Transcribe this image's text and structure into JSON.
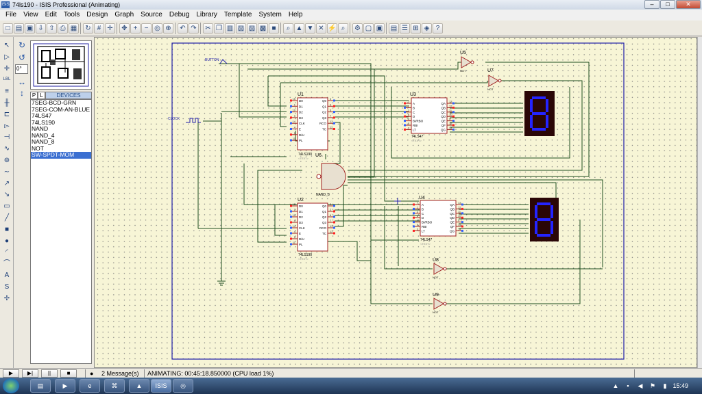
{
  "window": {
    "title": "74ls190 - ISIS Professional (Animating)",
    "app_icon": "ISIS",
    "minimize": "–",
    "maximize": "□",
    "close": "✕"
  },
  "menu": [
    "File",
    "View",
    "Edit",
    "Tools",
    "Design",
    "Graph",
    "Source",
    "Debug",
    "Library",
    "Template",
    "System",
    "Help"
  ],
  "toolbar_icons": [
    "new-file-icon",
    "open-folder-icon",
    "save-icon",
    "import-icon",
    "export-icon",
    "print-icon",
    "print-setup-icon",
    "refresh-icon",
    "grid-icon",
    "origin-icon",
    "pan-icon",
    "zoom-in-icon",
    "zoom-out-icon",
    "zoom-all-icon",
    "zoom-area-icon",
    "undo-icon",
    "redo-icon",
    "cut-icon",
    "copy-icon",
    "paste-icon",
    "block-copy-icon",
    "block-move-icon",
    "block-rotate-icon",
    "block-delete-icon",
    "pick-device-icon",
    "make-device-icon",
    "package-icon",
    "decompose-icon",
    "wire-autorouter-icon",
    "search-tag-icon",
    "property-tool-icon",
    "new-sheet-icon",
    "remove-sheet-icon",
    "goto-sheet-icon",
    "bom-icon",
    "netlist-icon",
    "design-explorer-icon",
    "help-icon"
  ],
  "tool_icons": [
    "selection-icon",
    "component-icon",
    "junction-icon",
    "wire-label-icon",
    "text-script-icon",
    "bus-icon",
    "subcircuit-icon",
    "terminal-icon",
    "device-pin-icon",
    "graph-icon",
    "tape-recorder-icon",
    "generator-icon",
    "voltage-probe-icon",
    "current-probe-icon",
    "virtual-instrument-icon",
    "line-icon",
    "box-icon",
    "circle-icon",
    "arc-icon",
    "path-icon",
    "text-icon",
    "symbol-icon",
    "marker-icon"
  ],
  "orientation": {
    "rotate_cw": "↻",
    "rotate_ccw": "↺",
    "angle": "0°",
    "mirror_x": "↔",
    "mirror_y": "↕"
  },
  "devices": {
    "tab_p": "P",
    "tab_l": "L",
    "title": "DEVICES",
    "items": [
      "7SEG-BCD-GRN",
      "7SEG-COM-AN-BLUE",
      "74LS47",
      "74LS190",
      "NAND",
      "NAND_4",
      "NAND_8",
      "NOT",
      "SW-SPDT-MOM"
    ],
    "selected_index": 8
  },
  "schematic": {
    "u1": {
      "ref": "U1",
      "part": "74LS190",
      "pins_left": [
        "D0",
        "D1",
        "D2",
        "D3",
        "CLK",
        "E",
        "D/U",
        "PL"
      ],
      "pins_right": [
        "Q0",
        "Q1",
        "Q2",
        "Q3",
        "RCO",
        "TC"
      ],
      "pinnums_left": [
        "15",
        "1",
        "10",
        "9",
        "14",
        "4",
        "5",
        "11"
      ],
      "pinnums_right": [
        "3",
        "2",
        "6",
        "7",
        "13",
        "12"
      ]
    },
    "u2": {
      "ref": "U2",
      "part": "74LS190",
      "subtitle": "NAND_8",
      "pins_left": [
        "D0",
        "D1",
        "D2",
        "D3",
        "CLK",
        "E",
        "D/U",
        "PL"
      ],
      "pins_right": [
        "Q0",
        "Q1",
        "Q2",
        "Q3",
        "RCO",
        "TC"
      ],
      "pinnums_left": [
        "15",
        "1",
        "10",
        "9",
        "14",
        "4",
        "5",
        "11"
      ],
      "pinnums_right": [
        "3",
        "2",
        "6",
        "7",
        "13",
        "12"
      ]
    },
    "u3": {
      "ref": "U3",
      "part": "74LS47",
      "pins_left": [
        "A",
        "B",
        "C",
        "D",
        "BI/RBO",
        "RBI",
        "LT"
      ],
      "pins_right": [
        "QA",
        "QB",
        "QC",
        "QD",
        "QE",
        "QF",
        "QG"
      ],
      "pinnums_left": [
        "7",
        "1",
        "2",
        "6",
        "4",
        "5",
        "3"
      ],
      "pinnums_right": [
        "13",
        "12",
        "11",
        "10",
        "9",
        "15",
        "14"
      ]
    },
    "u4": {
      "ref": "U4",
      "part": "74LS47",
      "pins_left": [
        "A",
        "B",
        "C",
        "D",
        "BI/RBO",
        "RBI",
        "LT"
      ],
      "pins_right": [
        "QA",
        "QB",
        "QC",
        "QD",
        "QE",
        "QF",
        "QG"
      ],
      "pinnums_left": [
        "7",
        "1",
        "2",
        "6",
        "4",
        "5",
        "3"
      ],
      "pinnums_right": [
        "13",
        "12",
        "11",
        "10",
        "9",
        "15",
        "14"
      ]
    },
    "u5": {
      "ref": "U5",
      "part": "NOT"
    },
    "u6": {
      "ref": "U6"
    },
    "u7": {
      "ref": "U7",
      "part": "NOT"
    },
    "u8": {
      "ref": "U8",
      "part": "NOT"
    },
    "u9": {
      "ref": "U9",
      "part": "NOT"
    },
    "switch_label": "BUTTON",
    "clock_label": "CLOCK",
    "placeholder": "<TEXT>"
  },
  "status": {
    "controls": [
      "▶",
      "▶|",
      "||",
      "■"
    ],
    "messages": "2 Message(s)",
    "animating": "ANIMATING: 00:45:18.850000 (CPU load 1%)"
  },
  "taskbar": {
    "apps": [
      "folder-icon",
      "media-player-icon",
      "ie-icon",
      "network-icon",
      "vlc-icon",
      "isis-icon",
      "proteus-icon"
    ],
    "active_label": "ISIS",
    "clock": "15:49"
  },
  "colors": {
    "canvas": "#f7f5d6",
    "wire": "#1d4d1d",
    "component": "#a02020",
    "sheet_border": "#1c1ca8",
    "seg_on": "#2424ff",
    "seg_body": "#2a0606",
    "pin_low": "#3060ff",
    "pin_high": "#ff2020"
  }
}
